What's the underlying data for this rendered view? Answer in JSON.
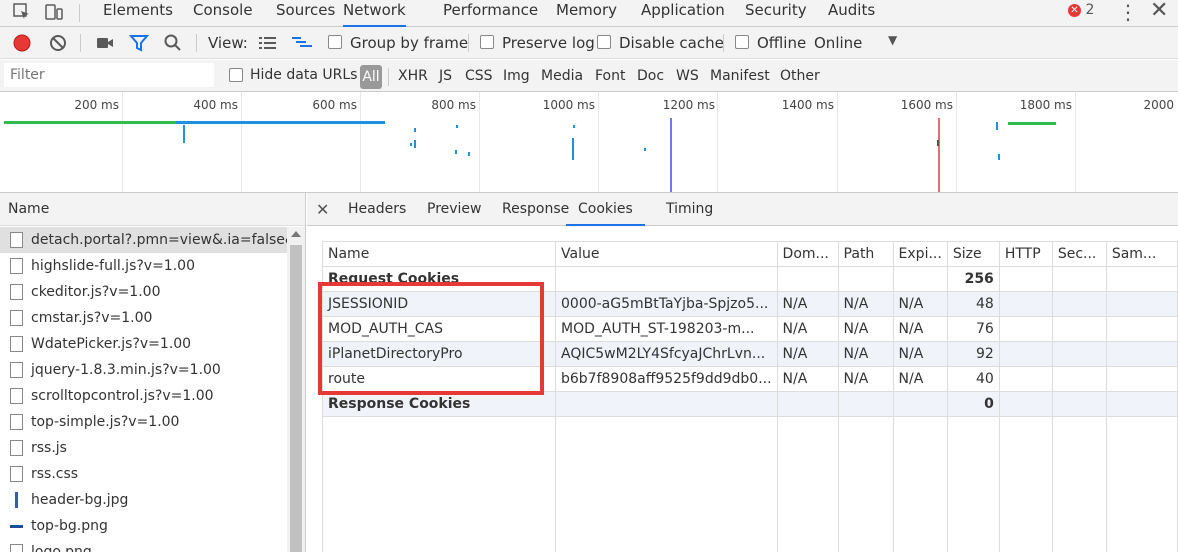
{
  "devtools": {
    "tabs": [
      "Elements",
      "Console",
      "Sources",
      "Network",
      "Performance",
      "Memory",
      "Application",
      "Security",
      "Audits"
    ],
    "active_tab": "Network",
    "error_count": "2"
  },
  "toolbar": {
    "view_label": "View:",
    "group_by_frame": "Group by frame",
    "preserve_log": "Preserve log",
    "disable_cache": "Disable cache",
    "offline": "Offline",
    "throttle_value": "Online"
  },
  "filter": {
    "placeholder": "Filter",
    "hide_data_urls": "Hide data URLs",
    "types": [
      "All",
      "XHR",
      "JS",
      "CSS",
      "Img",
      "Media",
      "Font",
      "Doc",
      "WS",
      "Manifest",
      "Other"
    ],
    "active_type": "All"
  },
  "overview": {
    "ticks": [
      "200 ms",
      "400 ms",
      "600 ms",
      "800 ms",
      "1000 ms",
      "1200 ms",
      "1400 ms",
      "1600 ms",
      "1800 ms",
      "2000"
    ]
  },
  "requests": {
    "header": "Name",
    "items": [
      "detach.portal?.pmn=view&.ia=false&action=bulletinPageList&search=true&group",
      "highslide-full.js?v=1.00",
      "ckeditor.js?v=1.00",
      "cmstar.js?v=1.00",
      "WdatePicker.js?v=1.00",
      "jquery-1.8.3.min.js?v=1.00",
      "scrolltopcontrol.js?v=1.00",
      "top-simple.js?v=1.00",
      "rss.js",
      "rss.css",
      "header-bg.jpg",
      "top-bg.png",
      "logo.png"
    ]
  },
  "detail": {
    "tabs": [
      "Headers",
      "Preview",
      "Response",
      "Cookies",
      "Timing"
    ],
    "active_tab": "Cookies",
    "columns": [
      "Name",
      "Value",
      "Dom...",
      "Path",
      "Expi...",
      "Size",
      "HTTP",
      "Sec...",
      "Sam..."
    ],
    "request_group": {
      "label": "Request Cookies",
      "size": "256"
    },
    "cookies": [
      {
        "name": "JSESSIONID",
        "value": "0000-aG5mBtTaYjba-Spjzo5...",
        "domain": "N/A",
        "path": "N/A",
        "expires": "N/A",
        "size": "48"
      },
      {
        "name": "MOD_AUTH_CAS",
        "value": "MOD_AUTH_ST-198203-m...",
        "domain": "N/A",
        "path": "N/A",
        "expires": "N/A",
        "size": "76"
      },
      {
        "name": "iPlanetDirectoryPro",
        "value": "AQIC5wM2LY4SfcyaJChrLvn...",
        "domain": "N/A",
        "path": "N/A",
        "expires": "N/A",
        "size": "92"
      },
      {
        "name": "route",
        "value": "b6b7f8908aff9525f9dd9db0...",
        "domain": "N/A",
        "path": "N/A",
        "expires": "N/A",
        "size": "40"
      }
    ],
    "response_group": {
      "label": "Response Cookies",
      "size": "0"
    }
  },
  "colors": {
    "accent": "#1a73e8",
    "record": "#e53935",
    "highlight_box": "#e53935",
    "timeline_green": "#2ebd4e",
    "timeline_blue": "#1e90e0"
  }
}
